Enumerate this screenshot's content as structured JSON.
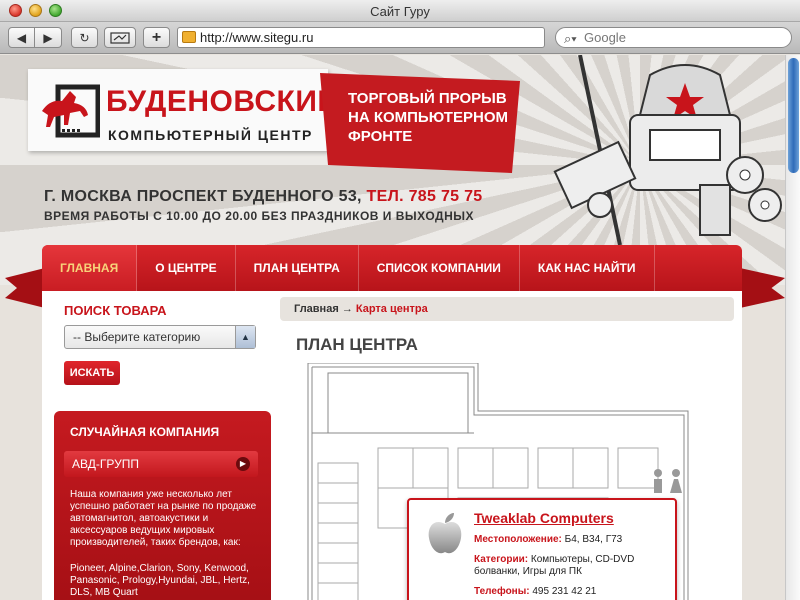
{
  "window": {
    "title": "Сайт Гуру"
  },
  "browser": {
    "url": "http://www.sitegu.ru",
    "search_placeholder": "Google",
    "add_label": "+"
  },
  "site": {
    "logo_name": "БУДЕНОВСКИЙ",
    "logo_sub": "КОМПЬЮТЕРНЫЙ ЦЕНТР",
    "slogan": [
      "ТОРГОВЫЙ ПРОРЫВ",
      "НА КОМПЬЮТЕРНОМ",
      "ФРОНТЕ"
    ],
    "address": "Г. МОСКВА ПРОСПЕКТ БУДЕННОГО 53,",
    "phone": "ТЕЛ. 785 75 75",
    "hours": "ВРЕМЯ РАБОТЫ С 10.00 ДО 20.00 БЕЗ ПРАЗДНИКОВ И ВЫХОДНЫХ"
  },
  "nav": {
    "items": [
      "ГЛАВНАЯ",
      "О ЦЕНТРЕ",
      "ПЛАН ЦЕНТРА",
      "СПИСОК КОМПАНИИ",
      "КАК НАС НАЙТИ"
    ]
  },
  "search_panel": {
    "title": "ПОИСК ТОВАРА",
    "select_value": "-- Выберите категорию",
    "button": "ИСКАТЬ"
  },
  "random": {
    "title": "СЛУЧАЙНАЯ КОМПАНИЯ",
    "company": "АВД-ГРУПП",
    "description": "Наша компания уже несколько лет успешно работает на рынке по продаже автомагнитол, автоакустики и аксессуаров ведущих мировых производителей, таких брендов, как:",
    "brands": "Pioneer, Alpine,Clarion, Sony, Kenwood, Panasonic, Prology,Hyundai, JBL, Hertz, DLS, MB Quart"
  },
  "main": {
    "breadcrumb_home": "Главная",
    "breadcrumb_sep": "→",
    "breadcrumb_current": "Карта центра",
    "title": "ПЛАН ЦЕНТРА"
  },
  "popup": {
    "name": "Tweaklab Computers",
    "location_label": "Местоположение:",
    "location_value": "Б4, В34, Г73",
    "categories_label": "Категории:",
    "categories_value": "Компьютеры, CD-DVD болванки, Игры для ПК",
    "phone_label": "Телефоны:",
    "phone_value": "495 231 42 21"
  },
  "colors": {
    "brand_red": "#c8141b",
    "accent_yellow": "#f7d37a"
  }
}
